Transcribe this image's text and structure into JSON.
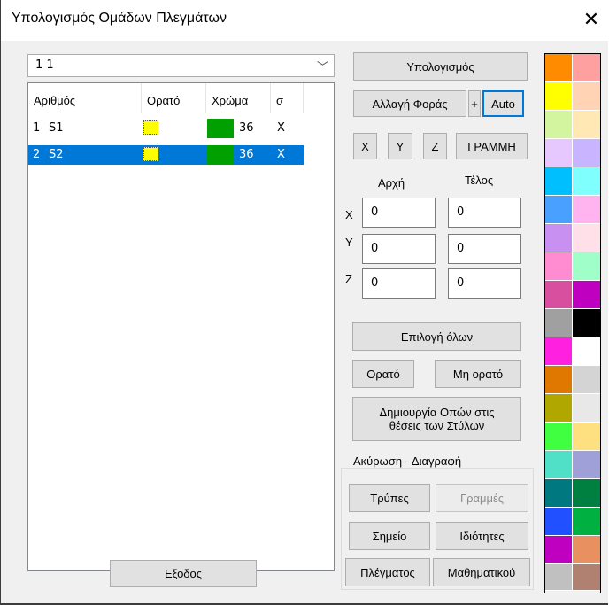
{
  "window": {
    "title": "Υπολογισμός Ομάδων Πλεγμάτων",
    "close_glyph": "✕"
  },
  "combo": {
    "value": "1 1",
    "arrow": "﹀"
  },
  "list": {
    "headers": [
      "Αριθμός",
      "Ορατό",
      "Χρώμα",
      "σ"
    ],
    "rows": [
      {
        "number": "1",
        "name": "S1",
        "value": "36",
        "sigma": "X",
        "color": "#00a000",
        "visible_color": "#ffff00"
      },
      {
        "number": "2",
        "name": "S2",
        "value": "36",
        "sigma": "X",
        "color": "#00a000",
        "visible_color": "#ffff00"
      }
    ]
  },
  "buttons": {
    "calculate": "Υπολογισμός",
    "change_direction": "Αλλαγή Φοράς",
    "plus": "+",
    "auto": "Auto",
    "x": "X",
    "y": "Y",
    "z": "Z",
    "line": "ΓΡΑΜΜΗ",
    "select_all": "Επιλογή όλων",
    "visible": "Ορατό",
    "not_visible": "Μη ορατό",
    "create_holes_line1": "Δημιουργία Οπών στις",
    "create_holes_line2": "θέσεις των Στύλων",
    "holes": "Τρύπες",
    "lines": "Γραμμές",
    "point": "Σημείο",
    "properties": "Ιδιότητες",
    "mesh": "Πλέγματος",
    "math": "Μαθηματικού",
    "exit": "Εξοδος"
  },
  "coords": {
    "start_label": "Αρχή",
    "end_label": "Τέλος",
    "x_label": "X",
    "y_label": "Y",
    "z_label": "Z",
    "x_start": "0",
    "x_end": "0",
    "y_start": "0",
    "y_end": "0",
    "z_start": "0",
    "z_end": "0"
  },
  "group_title": "Ακύρωση - Διαγραφή",
  "palette": [
    [
      "#ff8c00",
      "#ffa0a0"
    ],
    [
      "#ffff00",
      "#ffd3b4"
    ],
    [
      "#d4f5a0",
      "#ffe8b4"
    ],
    [
      "#e6c8ff",
      "#c8b4ff"
    ],
    [
      "#00bfff",
      "#80ffff"
    ],
    [
      "#4aa0ff",
      "#ffb4f0"
    ],
    [
      "#c890f0",
      "#ffe0e8"
    ],
    [
      "#ff8cd0",
      "#a0ffc8"
    ],
    [
      "#d94fa0",
      "#c000c0"
    ],
    [
      "#a0a0a0",
      "#000000"
    ],
    [
      "#ff20e0",
      "#ffffff"
    ],
    [
      "#e07800",
      "#d4d4d4"
    ],
    [
      "#b0a800",
      "#e8e8e8"
    ],
    [
      "#40ff40",
      "#ffe080"
    ],
    [
      "#50e0c8",
      "#a0a0d8"
    ],
    [
      "#007880",
      "#008040"
    ],
    [
      "#2050ff",
      "#00b040"
    ],
    [
      "#c000c0",
      "#e89060"
    ],
    [
      "#c0c0c0",
      "#b08070"
    ]
  ]
}
